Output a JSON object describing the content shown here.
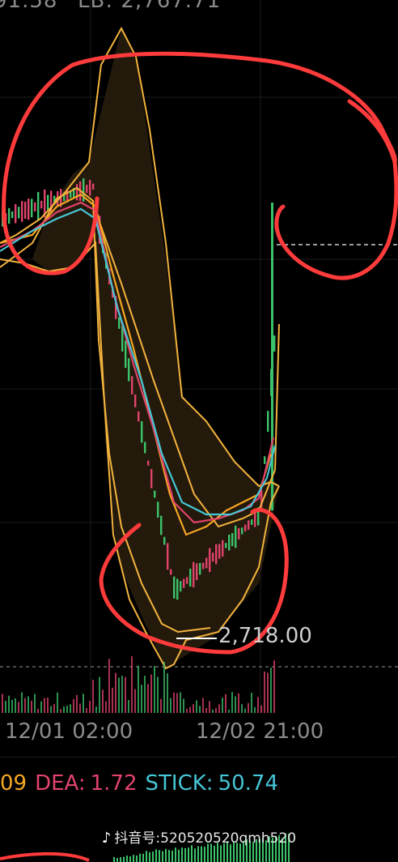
{
  "header": {
    "left_partial": "91.58",
    "lb_label": "LB: 2,767.71"
  },
  "price_marker": {
    "low_value": "2,718.00"
  },
  "time_axis": {
    "labels": [
      "12/01 02:00",
      "12/02 21:00"
    ]
  },
  "macd": {
    "dif_partial": "09",
    "dea_label": "DEA:",
    "dea_value": "1.72",
    "stick_label": "STICK:",
    "stick_value": "50.74"
  },
  "watermark": {
    "platform": "抖音号:",
    "account": "520520520qmh520"
  },
  "colors": {
    "background": "#000000",
    "up_candle": "#3cc26a",
    "down_candle": "#e0436b",
    "ma_orange": "#f5a623",
    "ma_pink": "#e0436b",
    "ma_cyan": "#46c6d6",
    "band_yellow": "#f3b33d",
    "annotation_red": "#ff3b3b",
    "dea_color": "#e0436b",
    "stick_color": "#46c6d6"
  }
}
